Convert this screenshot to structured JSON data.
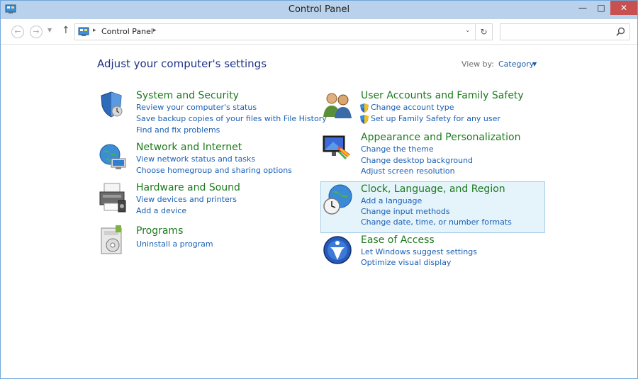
{
  "window": {
    "title": "Control Panel",
    "minimize_label": "—",
    "maximize_label": "□",
    "close_label": "✕"
  },
  "nav": {
    "back_label": "←",
    "forward_label": "→",
    "recent_label": "▼",
    "up_label": "↑",
    "address_separator": "▸",
    "address_text": "Control Panel",
    "dropdown_label": "⌄",
    "refresh_label": "↻",
    "search_placeholder": ""
  },
  "main": {
    "heading": "Adjust your computer's settings",
    "viewby_label": "View by:",
    "viewby_value": "Category",
    "viewby_arrow": "▼"
  },
  "categories_left": [
    {
      "title": "System and Security",
      "icon": "shield-icon",
      "links": [
        "Review your computer's status",
        "Save backup copies of your files with File History",
        "Find and fix problems"
      ]
    },
    {
      "title": "Network and Internet",
      "icon": "globe-network-icon",
      "links": [
        "View network status and tasks",
        "Choose homegroup and sharing options"
      ]
    },
    {
      "title": "Hardware and Sound",
      "icon": "printer-icon",
      "links": [
        "View devices and printers",
        "Add a device"
      ]
    },
    {
      "title": "Programs",
      "icon": "programs-icon",
      "links": [
        "Uninstall a program"
      ]
    }
  ],
  "categories_right": [
    {
      "title": "User Accounts and Family Safety",
      "icon": "users-icon",
      "links": [
        "Change account type",
        "Set up Family Safety for any user"
      ]
    },
    {
      "title": "Appearance and Personalization",
      "icon": "appearance-icon",
      "links": [
        "Change the theme",
        "Change desktop background",
        "Adjust screen resolution"
      ]
    },
    {
      "title": "Clock, Language, and Region",
      "icon": "clock-globe-icon",
      "links": [
        "Add a language",
        "Change input methods",
        "Change date, time, or number formats"
      ]
    },
    {
      "title": "Ease of Access",
      "icon": "ease-of-access-icon",
      "links": [
        "Let Windows suggest settings",
        "Optimize visual display"
      ]
    }
  ],
  "colors": {
    "title_green": "#1d7a1d",
    "link_blue": "#1a5fb4",
    "heading_blue": "#1e3287",
    "highlight_bg": "#e5f3fb"
  }
}
